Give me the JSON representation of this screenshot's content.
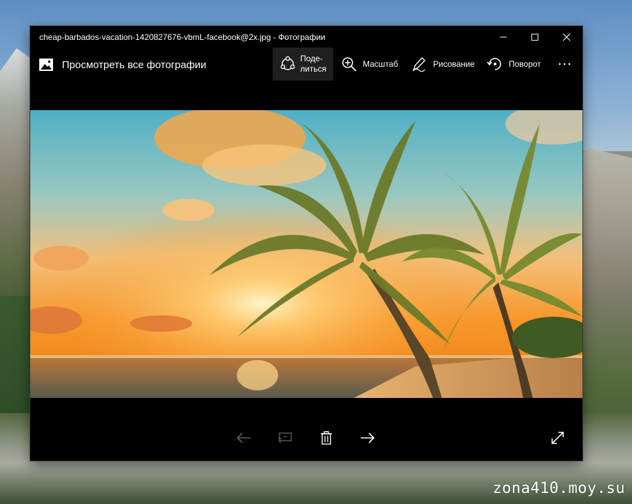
{
  "window": {
    "title": "cheap-barbados-vacation-1420827676-vbmL-facebook@2x.jpg - Фотографии"
  },
  "toolbar": {
    "gallery_label": "Просмотреть все фотографии",
    "share_label_1": "Поде-",
    "share_label_2": "литься",
    "zoom_label": "Масштаб",
    "draw_label": "Рисование",
    "rotate_label": "Поворот"
  },
  "watermark": "zona410.moy.su",
  "colors": {
    "window_bg": "#000000",
    "share_highlight": "#1f1f1f",
    "icon_enabled": "#ffffff",
    "icon_disabled": "#5f5f5f"
  },
  "icons": {
    "gallery": "photos-gallery-icon",
    "share": "share-icon",
    "zoom": "zoom-in-icon",
    "draw": "pen-icon",
    "rotate": "rotate-icon",
    "more": "more-icon",
    "prev": "arrow-left-icon",
    "slideshow": "slideshow-icon",
    "delete": "trash-icon",
    "next": "arrow-right-icon",
    "fullscreen": "fullscreen-icon"
  }
}
